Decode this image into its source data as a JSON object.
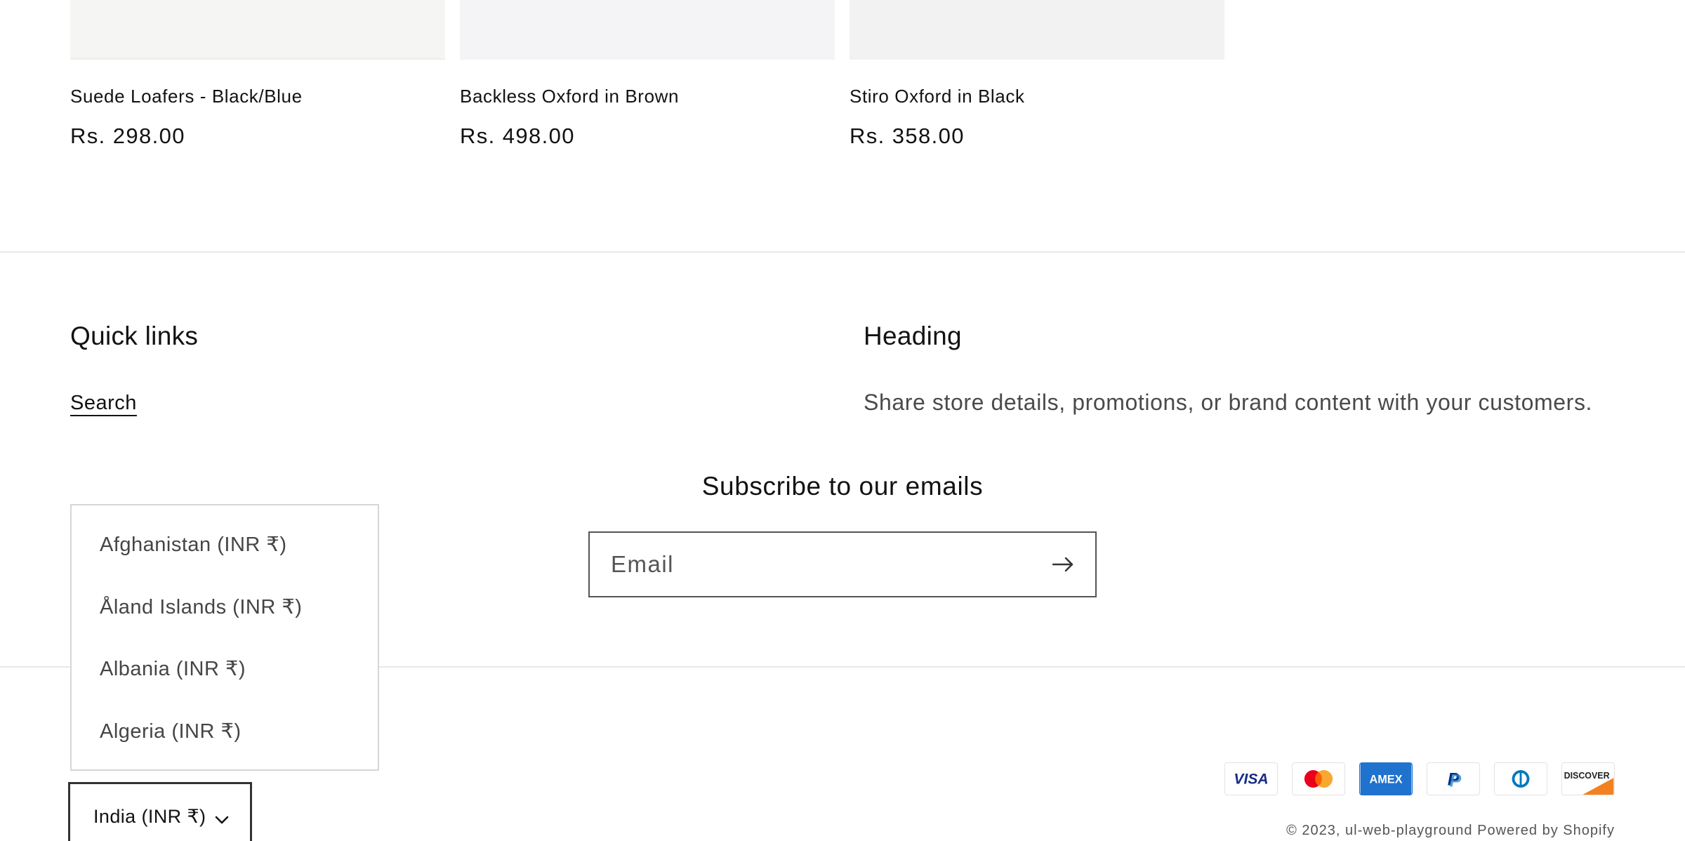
{
  "products": [
    {
      "title": "Suede Loafers - Black/Blue",
      "price": "Rs. 298.00"
    },
    {
      "title": "Backless Oxford in Brown",
      "price": "Rs. 498.00"
    },
    {
      "title": "Stiro Oxford in Black",
      "price": "Rs. 358.00"
    }
  ],
  "footer": {
    "quick_links": {
      "heading": "Quick links",
      "links": [
        "Search"
      ]
    },
    "brand": {
      "heading": "Heading",
      "text": "Share store details, promotions, or brand content with your customers."
    },
    "subscribe": {
      "heading": "Subscribe to our emails",
      "placeholder": "Email",
      "submit_icon": "arrow-right-icon"
    }
  },
  "country_selector": {
    "options": [
      "Afghanistan (INR ₹)",
      "Åland Islands (INR ₹)",
      "Albania (INR ₹)",
      "Algeria (INR ₹)"
    ],
    "selected": "India (INR ₹)",
    "expand_icon": "chevron-down-icon"
  },
  "payment_methods": [
    "Visa",
    "Mastercard",
    "American Express",
    "PayPal",
    "Diners Club",
    "Discover"
  ],
  "copyright": "© 2023, ul-web-playground Powered by Shopify"
}
